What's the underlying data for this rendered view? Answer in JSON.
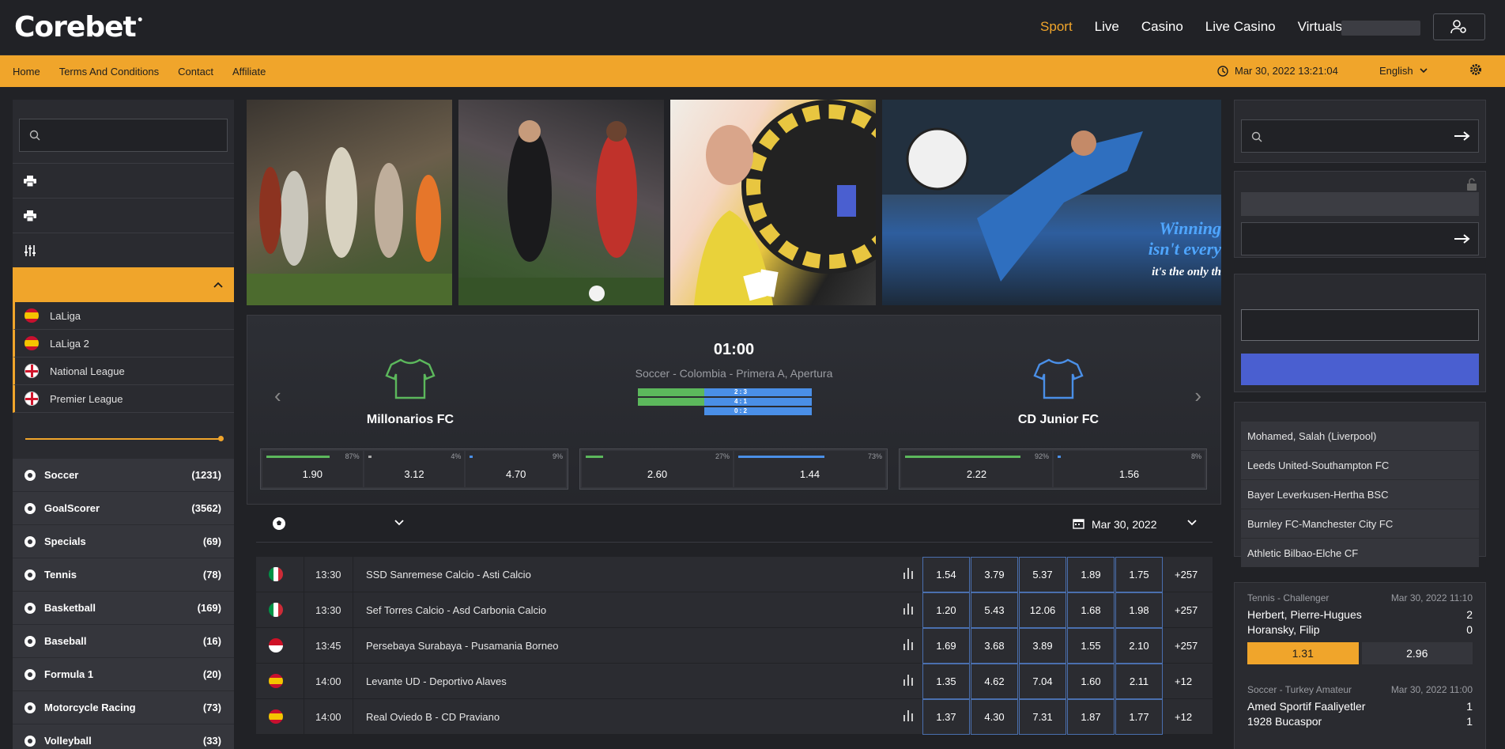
{
  "header": {
    "logo": "Corebet",
    "logo_mark": "•",
    "nav": [
      "Sport",
      "Live",
      "Casino",
      "Live Casino",
      "Virtuals"
    ],
    "active_nav": "Sport"
  },
  "subbar": {
    "links": [
      "Home",
      "Terms And Conditions",
      "Contact",
      "Affiliate"
    ],
    "datetime": "Mar 30, 2022 13:21:04",
    "language": "English"
  },
  "left": {
    "leagues": [
      {
        "name": "LaLiga",
        "flag": "es"
      },
      {
        "name": "LaLiga 2",
        "flag": "es"
      },
      {
        "name": "National League",
        "flag": "en"
      },
      {
        "name": "Premier League",
        "flag": "en"
      }
    ],
    "sports": [
      {
        "name": "Soccer",
        "count": "(1231)",
        "icon": "soccer-ball-icon"
      },
      {
        "name": "GoalScorer",
        "count": "(3562)",
        "icon": "goalscorer-icon"
      },
      {
        "name": "Specials",
        "count": "(69)",
        "icon": "specials-icon"
      },
      {
        "name": "Tennis",
        "count": "(78)",
        "icon": "tennis-ball-icon"
      },
      {
        "name": "Basketball",
        "count": "(169)",
        "icon": "basketball-icon"
      },
      {
        "name": "Baseball",
        "count": "(16)",
        "icon": "baseball-icon"
      },
      {
        "name": "Formula 1",
        "count": "(20)",
        "icon": "formula1-icon"
      },
      {
        "name": "Motorcycle Racing",
        "count": "(73)",
        "icon": "motorcycle-icon"
      },
      {
        "name": "Volleyball",
        "count": "(33)",
        "icon": "volleyball-icon"
      }
    ]
  },
  "banners": {
    "b4_line1": "Winning",
    "b4_line2": "isn't every",
    "b4_line3": "it's the only th"
  },
  "featured": {
    "time": "01:00",
    "league": "Soccer - Colombia - Primera A, Apertura",
    "home": "Millonarios FC",
    "away": "CD Junior FC",
    "score_bars": [
      {
        "label": "2 : 3",
        "home_frac": 0.4
      },
      {
        "label": "4 : 1",
        "home_frac": 0.8
      },
      {
        "label": "0 : 2",
        "home_frac": 0.0
      }
    ],
    "odds_groups": [
      [
        {
          "pct": "87%",
          "val": "1.90",
          "frac": 0.87,
          "color": "#5cb85c"
        },
        {
          "pct": "4%",
          "val": "3.12",
          "frac": 0.04,
          "color": "#aaaaaa"
        },
        {
          "pct": "9%",
          "val": "4.70",
          "frac": 0.09,
          "color": "#4a8fe7"
        }
      ],
      [
        {
          "pct": "27%",
          "val": "2.60",
          "frac": 0.27,
          "color": "#5cb85c"
        },
        {
          "pct": "73%",
          "val": "1.44",
          "frac": 0.73,
          "color": "#4a8fe7"
        }
      ],
      [
        {
          "pct": "92%",
          "val": "2.22",
          "frac": 0.92,
          "color": "#5cb85c"
        },
        {
          "pct": "8%",
          "val": "1.56",
          "frac": 0.08,
          "color": "#4a8fe7"
        }
      ]
    ]
  },
  "filter": {
    "date": "Mar 30, 2022"
  },
  "events": [
    {
      "flag": "it",
      "time": "13:30",
      "name": "SSD Sanremese Calcio - Asti Calcio",
      "odds": [
        "1.54",
        "3.79",
        "5.37",
        "1.89",
        "1.75"
      ],
      "more": "+257"
    },
    {
      "flag": "it",
      "time": "13:30",
      "name": "Sef Torres Calcio - Asd Carbonia Calcio",
      "odds": [
        "1.20",
        "5.43",
        "12.06",
        "1.68",
        "1.98"
      ],
      "more": "+257"
    },
    {
      "flag": "id",
      "time": "13:45",
      "name": "Persebaya Surabaya - Pusamania Borneo",
      "odds": [
        "1.69",
        "3.68",
        "3.89",
        "1.55",
        "2.10"
      ],
      "more": "+257"
    },
    {
      "flag": "es",
      "time": "14:00",
      "name": "Levante UD - Deportivo Alaves",
      "odds": [
        "1.35",
        "4.62",
        "7.04",
        "1.60",
        "2.11"
      ],
      "more": "+12"
    },
    {
      "flag": "es",
      "time": "14:00",
      "name": "Real Oviedo B - CD Praviano",
      "odds": [
        "1.37",
        "4.30",
        "7.31",
        "1.87",
        "1.77"
      ],
      "more": "+12"
    }
  ],
  "right": {
    "top_list": [
      "Mohamed, Salah (Liverpool)",
      "Leeds United-Southampton FC",
      "Bayer Leverkusen-Hertha BSC",
      "Burnley FC-Manchester City FC",
      "Athletic Bilbao-Elche CF"
    ],
    "live": [
      {
        "league": "Tennis - Challenger",
        "date": "Mar 30, 2022 11:10",
        "p1": "Herbert, Pierre-Hugues",
        "s1": "2",
        "p2": "Horansky, Filip",
        "s2": "0",
        "o1": "1.31",
        "o2": "2.96"
      },
      {
        "league": "Soccer - Turkey Amateur",
        "date": "Mar 30, 2022 11:00",
        "p1": "Amed Sportif Faaliyetler",
        "s1": "1",
        "p2": "1928 Bucaspor",
        "s2": "1"
      }
    ]
  },
  "colors": {
    "accent": "#f0a52b",
    "bg": "#212226",
    "panel": "#2a2b30",
    "blue": "#4a5fd0"
  }
}
